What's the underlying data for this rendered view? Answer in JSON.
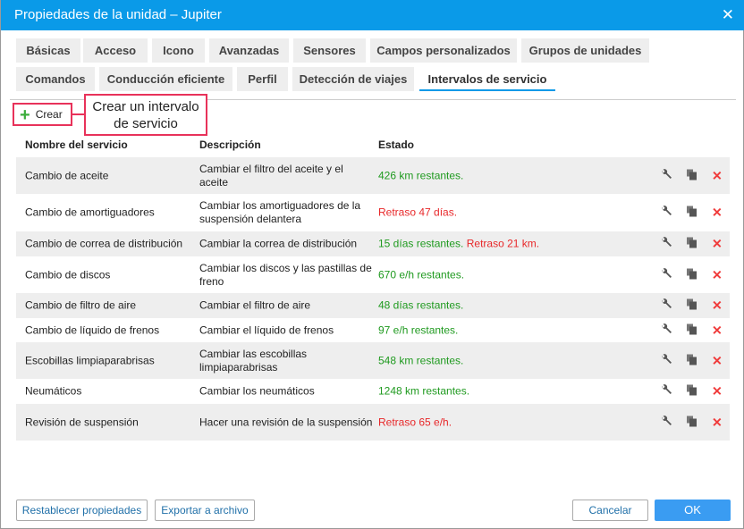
{
  "window": {
    "title": "Propiedades de la unidad – Jupiter",
    "close_icon": "close-icon"
  },
  "tabs": [
    {
      "label": "Básicas"
    },
    {
      "label": "Acceso"
    },
    {
      "label": "Icono"
    },
    {
      "label": "Avanzadas"
    },
    {
      "label": "Sensores"
    },
    {
      "label": "Campos personalizados"
    },
    {
      "label": "Grupos de unidades"
    },
    {
      "label": "Comandos"
    },
    {
      "label": "Conducción eficiente"
    },
    {
      "label": "Perfil"
    },
    {
      "label": "Detección de viajes"
    },
    {
      "label": "Intervalos de servicio",
      "active": true
    }
  ],
  "toolbar": {
    "create_label": "Crear",
    "callout": "Crear un intervalo de servicio"
  },
  "table": {
    "headers": [
      "Nombre del servicio",
      "Descripción",
      "Estado"
    ],
    "rows": [
      {
        "name": "Cambio de aceite",
        "desc": "Cambiar el filtro del aceite y el aceite",
        "status": [
          {
            "text": "426 km restantes.",
            "type": "ok"
          }
        ]
      },
      {
        "name": "Cambio de amortiguadores",
        "desc": "Cambiar los amortiguadores de la suspensión delantera",
        "status": [
          {
            "text": "Retraso 47 días.",
            "type": "bad"
          }
        ]
      },
      {
        "name": "Cambio de correa de distribución",
        "desc": "Cambiar la correa de distribución",
        "status": [
          {
            "text": "15 días restantes.",
            "type": "ok"
          },
          {
            "text": "Retraso 21 km.",
            "type": "bad"
          }
        ]
      },
      {
        "name": "Cambio de discos",
        "desc": "Cambiar los discos y las pastillas de freno",
        "status": [
          {
            "text": "670 e/h restantes.",
            "type": "ok"
          }
        ]
      },
      {
        "name": "Cambio de filtro de aire",
        "desc": "Cambiar el filtro de aire",
        "status": [
          {
            "text": "48 días restantes.",
            "type": "ok"
          }
        ]
      },
      {
        "name": "Cambio de líquido de frenos",
        "desc": "Cambiar el líquido de frenos",
        "status": [
          {
            "text": "97 e/h restantes.",
            "type": "ok"
          }
        ]
      },
      {
        "name": "Escobillas limpiaparabrisas",
        "desc": "Cambiar las escobillas limpiaparabrisas",
        "status": [
          {
            "text": "548 km restantes.",
            "type": "ok"
          }
        ]
      },
      {
        "name": "Neumáticos",
        "desc": "Cambiar los neumáticos",
        "status": [
          {
            "text": "1248 km restantes.",
            "type": "ok"
          }
        ]
      },
      {
        "name": "Revisión de suspensión",
        "desc": "Hacer una revisión de la suspensión",
        "status": [
          {
            "text": "Retraso 65 e/h.",
            "type": "bad"
          }
        ]
      }
    ]
  },
  "colors": {
    "ok": "#1f9a1f",
    "bad": "#e8282a",
    "accent": "#0a9ae8"
  },
  "footer": {
    "reset": "Restablecer propiedades",
    "export": "Exportar a archivo",
    "cancel": "Cancelar",
    "ok": "OK"
  }
}
